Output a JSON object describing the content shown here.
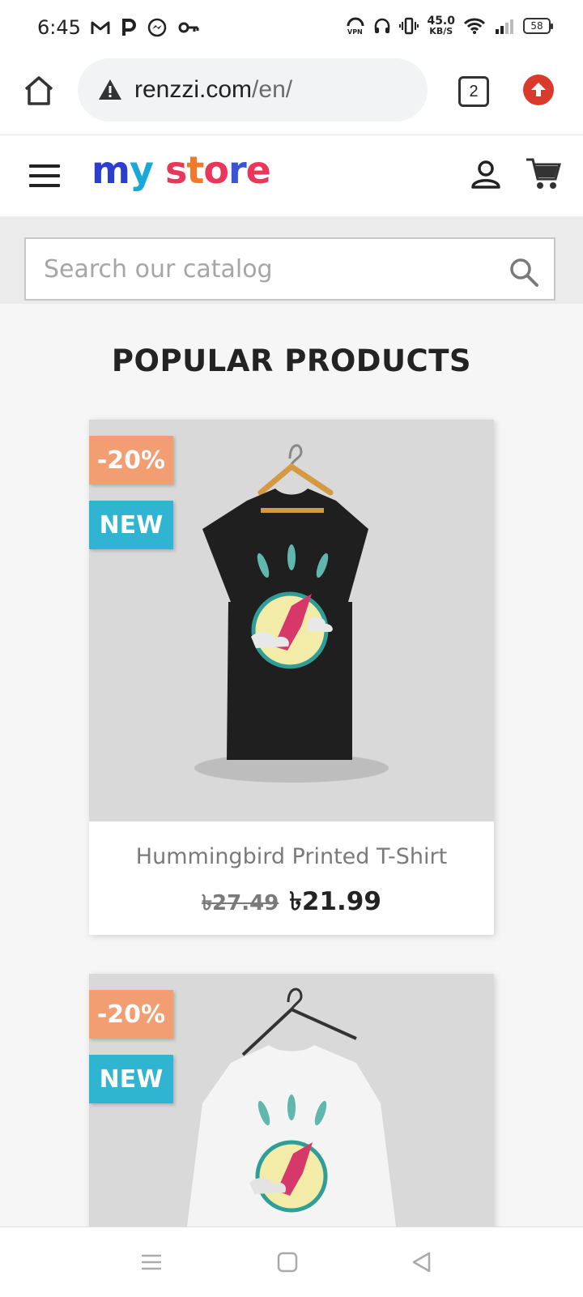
{
  "status_bar": {
    "time": "6:45",
    "net_speed_value": "45.0",
    "net_speed_unit": "KB/S",
    "battery": "58",
    "left_icons": [
      "gmail-icon",
      "p-icon",
      "messenger-icon",
      "key-icon"
    ],
    "right_icons": [
      "vpn-icon",
      "headset-icon",
      "vibrate-icon",
      "wifi-icon",
      "signal-icon",
      "battery-icon"
    ]
  },
  "browser": {
    "url_host": "renzzi.com",
    "url_path": "/en/",
    "tab_count": "2"
  },
  "store": {
    "logo_parts": [
      "m",
      "y",
      " ",
      "s",
      "t",
      "o",
      "r",
      "e"
    ],
    "logo_colors": [
      "#2b3ed0",
      "#1aa8d8",
      "",
      "#e8375b",
      "#f07a2a",
      "#e8375b",
      "#3b54d6",
      "#e8375b"
    ],
    "search_placeholder": "Search our catalog",
    "section_title": "POPULAR PRODUCTS"
  },
  "products": [
    {
      "discount_badge": "-20%",
      "new_badge": "NEW",
      "name": "Hummingbird Printed T-Shirt",
      "old_price": "৳27.49",
      "price": "৳21.99",
      "image": "black-tshirt-hummingbird"
    },
    {
      "discount_badge": "-20%",
      "new_badge": "NEW",
      "image": "white-sweater-hummingbird"
    }
  ],
  "navbar": {
    "buttons": [
      "menu-nav-icon",
      "home-nav-icon",
      "back-nav-icon"
    ]
  }
}
